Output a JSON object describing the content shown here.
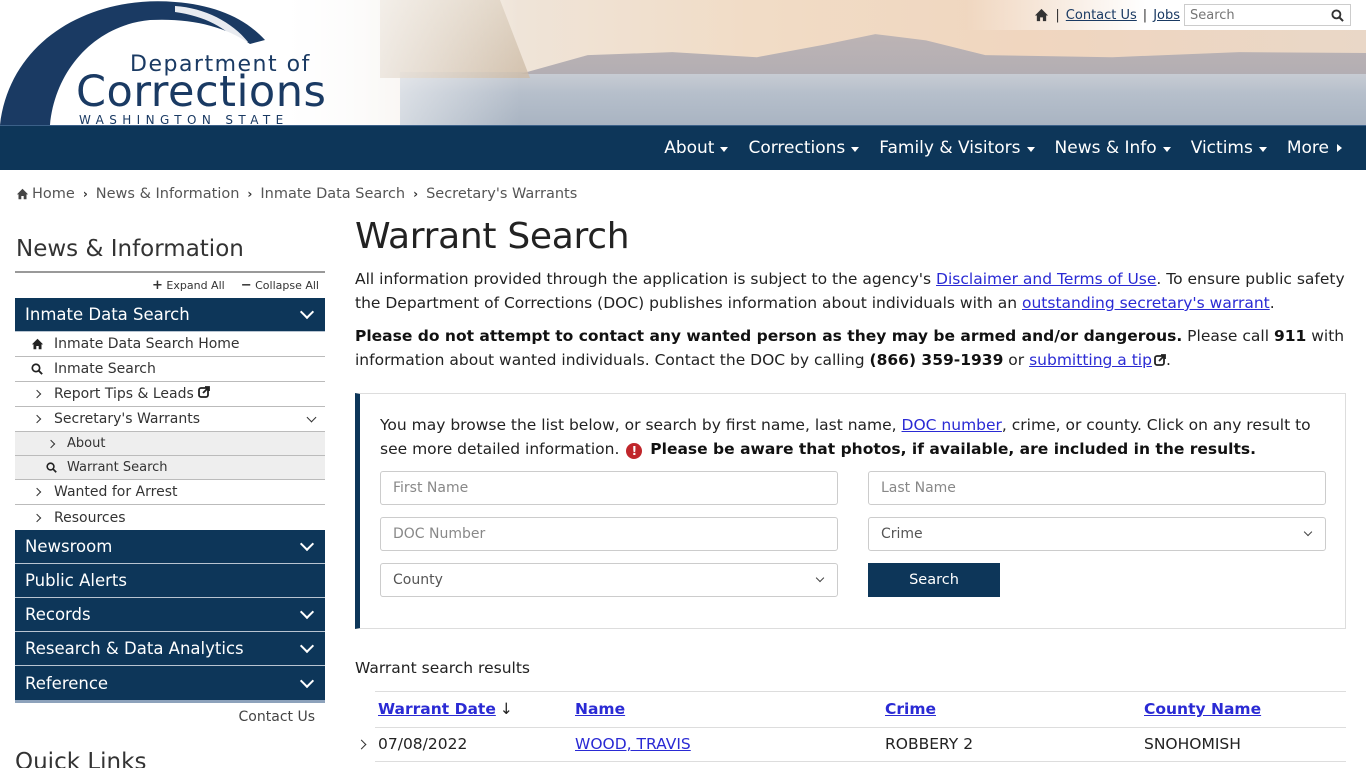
{
  "header": {
    "logo": {
      "line1": "Department of",
      "line2": "Corrections",
      "line3": "WASHINGTON STATE"
    },
    "utility": {
      "home_icon": "home-icon",
      "separator": "|",
      "contact_us": "Contact Us",
      "jobs": "Jobs",
      "search_placeholder": "Search"
    },
    "nav": [
      {
        "label": "About",
        "indicator": "caret-down"
      },
      {
        "label": "Corrections",
        "indicator": "caret-down"
      },
      {
        "label": "Family & Visitors",
        "indicator": "caret-down"
      },
      {
        "label": "News & Info",
        "indicator": "caret-down"
      },
      {
        "label": "Victims",
        "indicator": "caret-down"
      },
      {
        "label": "More",
        "indicator": "caret-right"
      }
    ]
  },
  "breadcrumb": [
    "Home",
    "News & Information",
    "Inmate Data Search",
    "Secretary's Warrants"
  ],
  "sidebar": {
    "title": "News & Information",
    "expand_all": "Expand All",
    "collapse_all": "Collapse All",
    "sections": [
      {
        "label": "Inmate Data Search",
        "expanded": true
      },
      {
        "label": "Newsroom"
      },
      {
        "label": "Public Alerts"
      },
      {
        "label": "Records"
      },
      {
        "label": "Research & Data Analytics"
      },
      {
        "label": "Reference"
      }
    ],
    "items": [
      {
        "label": "Inmate Data Search Home",
        "icon": "home-icon"
      },
      {
        "label": "Inmate Search",
        "icon": "search-icon"
      },
      {
        "label": "Report Tips & Leads",
        "icon": "chevron-right-icon",
        "external": true
      },
      {
        "label": "Secretary's Warrants",
        "icon": "chevron-right-icon",
        "expanded": true
      },
      {
        "label": "About",
        "icon": "chevron-right-icon"
      },
      {
        "label": "Warrant Search",
        "icon": "search-icon",
        "active": true
      },
      {
        "label": "Wanted for Arrest",
        "icon": "chevron-right-icon"
      },
      {
        "label": "Resources",
        "icon": "chevron-right-icon"
      }
    ],
    "contact_us": "Contact Us",
    "quick_links": "Quick Links"
  },
  "main": {
    "title": "Warrant Search",
    "p1": {
      "t1": "All information provided through the application is subject to the agency's ",
      "link1": "Disclaimer and Terms of Use",
      "t2": ". To ensure public safety the Department of Corrections (DOC) publishes information about individuals with an ",
      "link2": "outstanding secretary's warrant",
      "t3": "."
    },
    "p2": {
      "bold1": "Please do not attempt to contact any wanted person as they may be armed and/or dangerous.",
      "t1": " Please call ",
      "bold2": "911",
      "t2": " with information about wanted individuals. Contact the DOC by calling ",
      "bold3": "(866) 359-1939",
      "t3": " or ",
      "link": "submitting a tip",
      "t4": "."
    },
    "search_box": {
      "t1": "You may browse the list below, or search by first name, last name, ",
      "link": "DOC number",
      "t2": ", crime, or county. Click on any result to see more detailed information. ",
      "alert_icon": "!",
      "bold": "Please be aware that photos, if available, are included in the results.",
      "first_name_placeholder": "First Name",
      "first_name_value": "",
      "last_name_placeholder": "Last Name",
      "last_name_value": "",
      "doc_number_placeholder": "DOC Number",
      "doc_number_value": "",
      "crime_selected": "Crime",
      "county_selected": "County",
      "search_button": "Search"
    },
    "results": {
      "label": "Warrant search results",
      "columns": [
        "Warrant Date",
        "Name",
        "Crime",
        "County Name"
      ],
      "sort_indicator": "↓",
      "rows": [
        {
          "date": "07/08/2022",
          "name": "WOOD, TRAVIS",
          "crime": "ROBBERY 2",
          "county": "SNOHOMISH"
        }
      ]
    }
  },
  "colors": {
    "brand_navy": "#0d3659",
    "link": "#2a2ad4",
    "alert_red": "#c0262b",
    "submenu_bg": "#eeeeee"
  }
}
